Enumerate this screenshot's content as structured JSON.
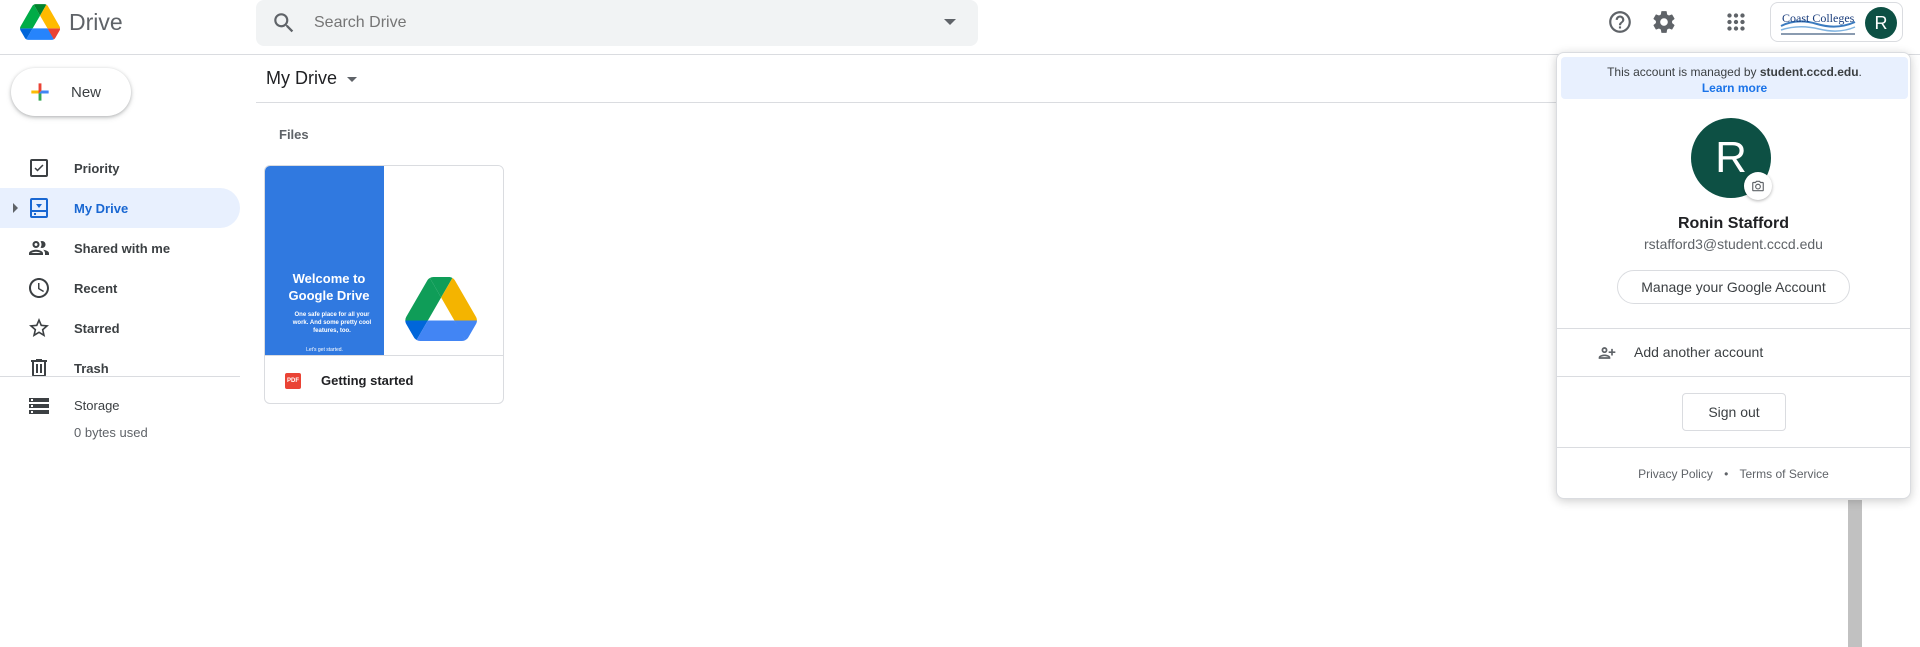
{
  "app": {
    "name": "Drive"
  },
  "search": {
    "placeholder": "Search Drive"
  },
  "org": {
    "logo_text": "Coast Colleges",
    "avatar_letter": "R"
  },
  "sidebar": {
    "new_label": "New",
    "items": [
      {
        "label": "Priority",
        "icon": "priority-icon"
      },
      {
        "label": "My Drive",
        "icon": "my-drive-icon",
        "active": true
      },
      {
        "label": "Shared with me",
        "icon": "shared-icon"
      },
      {
        "label": "Recent",
        "icon": "clock-icon"
      },
      {
        "label": "Starred",
        "icon": "star-icon"
      },
      {
        "label": "Trash",
        "icon": "trash-icon"
      }
    ],
    "storage_label": "Storage",
    "storage_used": "0 bytes used"
  },
  "main": {
    "title": "My Drive",
    "section": "Files",
    "files": [
      {
        "name": "Getting started",
        "type": "PDF",
        "thumb_title": "Welcome to Google Drive",
        "thumb_sub": "One safe place for all your work. And some pretty cool features, too.",
        "thumb_link": "Let's get started."
      }
    ]
  },
  "account_panel": {
    "managed_prefix": "This account is managed by",
    "managed_domain": "student.cccd.edu",
    "managed_suffix": ".",
    "learn_more": "Learn more",
    "avatar_letter": "R",
    "name": "Ronin Stafford",
    "email": "rstafford3@student.cccd.edu",
    "manage_label": "Manage your Google Account",
    "add_account": "Add another account",
    "sign_out": "Sign out",
    "privacy": "Privacy Policy",
    "separator": "•",
    "terms": "Terms of Service"
  },
  "colors": {
    "accent": "#1a73e8",
    "active_bg": "#e8f0fe",
    "avatar": "#0d5044",
    "thumb_blue": "#3079e0"
  }
}
